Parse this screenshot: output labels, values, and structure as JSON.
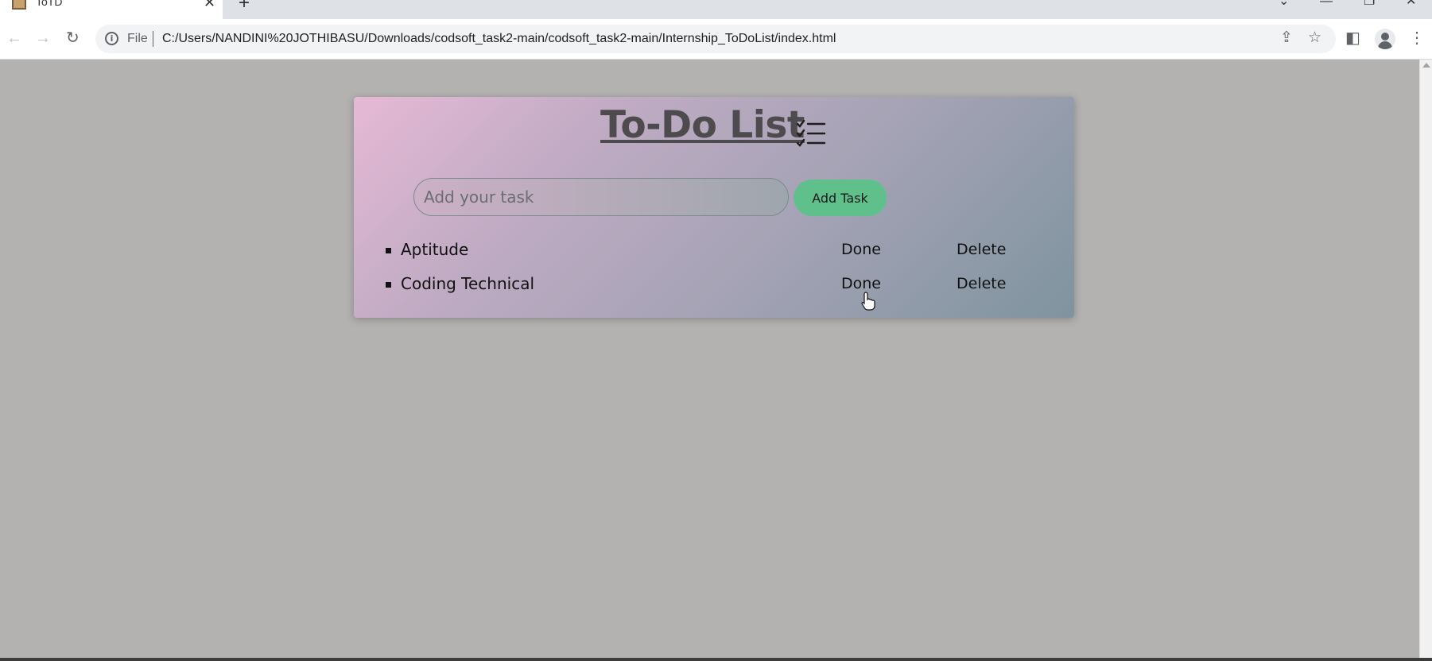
{
  "browser": {
    "tab_title": "ToTD",
    "tab_close": "✕",
    "new_tab": "+",
    "scheme_label": "File",
    "url": "C:/Users/NANDINI%20JOTHIBASU/Downloads/codsoft_task2-main/codsoft_task2-main/Internship_ToDoList/index.html",
    "icons": [
      "back-icon",
      "forward-icon",
      "reload-icon",
      "info-icon",
      "share-icon",
      "star-icon",
      "side-panel-icon",
      "profile-icon",
      "menu-icon",
      "tab-search-icon",
      "minimize-icon",
      "restore-icon",
      "close-window-icon"
    ]
  },
  "app": {
    "title": "To-Do List",
    "input_placeholder": "Add your task",
    "add_button": "Add Task",
    "tasks": [
      {
        "text": "Aptitude",
        "done_label": "Done",
        "delete_label": "Delete"
      },
      {
        "text": "Coding Technical",
        "done_label": "Done",
        "delete_label": "Delete"
      }
    ]
  },
  "colors": {
    "page_bg": "#b3b2b0",
    "card_gradient_start": "#e6b9d6",
    "card_gradient_end": "#7f949e",
    "add_button_bg": "#5fc08c",
    "title_color": "#4d4b4d"
  }
}
